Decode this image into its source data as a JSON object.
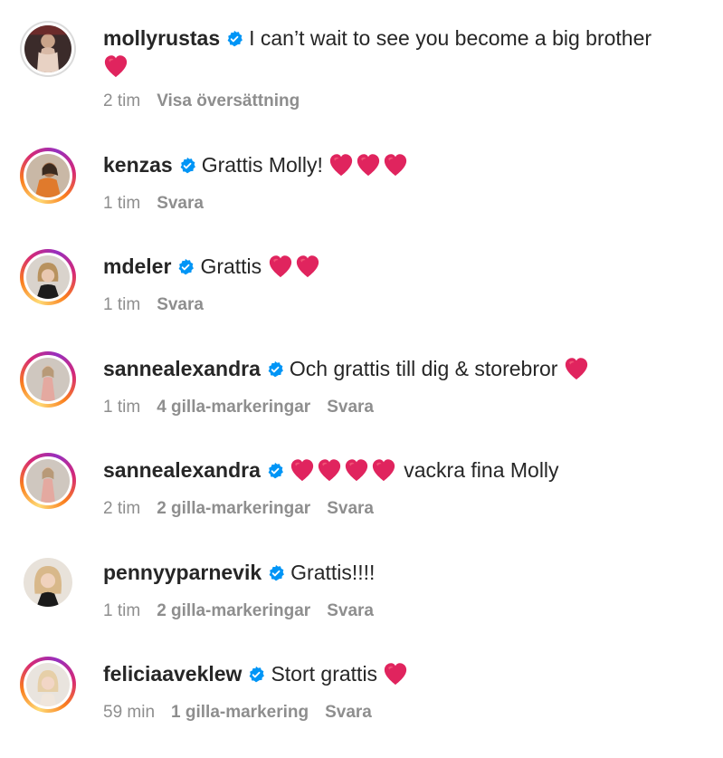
{
  "comments": [
    {
      "username": "mollyrustas",
      "verified": true,
      "text": "I can’t wait to see you become a big brother",
      "hearts": 1,
      "heart_position": "newline",
      "time": "2 tim",
      "likes": "",
      "action": "Visa översättning",
      "avatar_ring": "seen",
      "avatar": "profile-photo"
    },
    {
      "username": "kenzas",
      "verified": true,
      "text": "Grattis Molly!",
      "hearts": 3,
      "time": "1 tim",
      "likes": "",
      "action": "Svara",
      "avatar_ring": "story",
      "avatar": "profile-photo"
    },
    {
      "username": "mdeler",
      "verified": true,
      "text": "Grattis",
      "hearts": 2,
      "time": "1 tim",
      "likes": "",
      "action": "Svara",
      "avatar_ring": "story",
      "avatar": "profile-photo"
    },
    {
      "username": "sannealexandra",
      "verified": true,
      "text": "Och grattis till dig & storebror",
      "hearts": 1,
      "time": "1 tim",
      "likes": "4 gilla-markeringar",
      "action": "Svara",
      "avatar_ring": "story",
      "avatar": "profile-photo"
    },
    {
      "username": "sannealexandra",
      "verified": true,
      "text": "vackra fina Molly",
      "hearts": 4,
      "heart_position": "before",
      "time": "2 tim",
      "likes": "2 gilla-markeringar",
      "action": "Svara",
      "avatar_ring": "story",
      "avatar": "profile-photo"
    },
    {
      "username": "pennyyparnevik",
      "verified": true,
      "text": "Grattis!!!!",
      "hearts": 0,
      "time": "1 tim",
      "likes": "2 gilla-markeringar",
      "action": "Svara",
      "avatar_ring": "none",
      "avatar": "profile-photo"
    },
    {
      "username": "feliciaaveklew",
      "verified": true,
      "text": "Stort grattis",
      "hearts": 1,
      "time": "59 min",
      "likes": "1 gilla-markering",
      "action": "Svara",
      "avatar_ring": "story",
      "avatar": "profile-photo"
    }
  ],
  "colors": {
    "verified": "#0095f6",
    "heart": "#e0245e",
    "meta": "#8e8e8e",
    "text": "#262626"
  }
}
